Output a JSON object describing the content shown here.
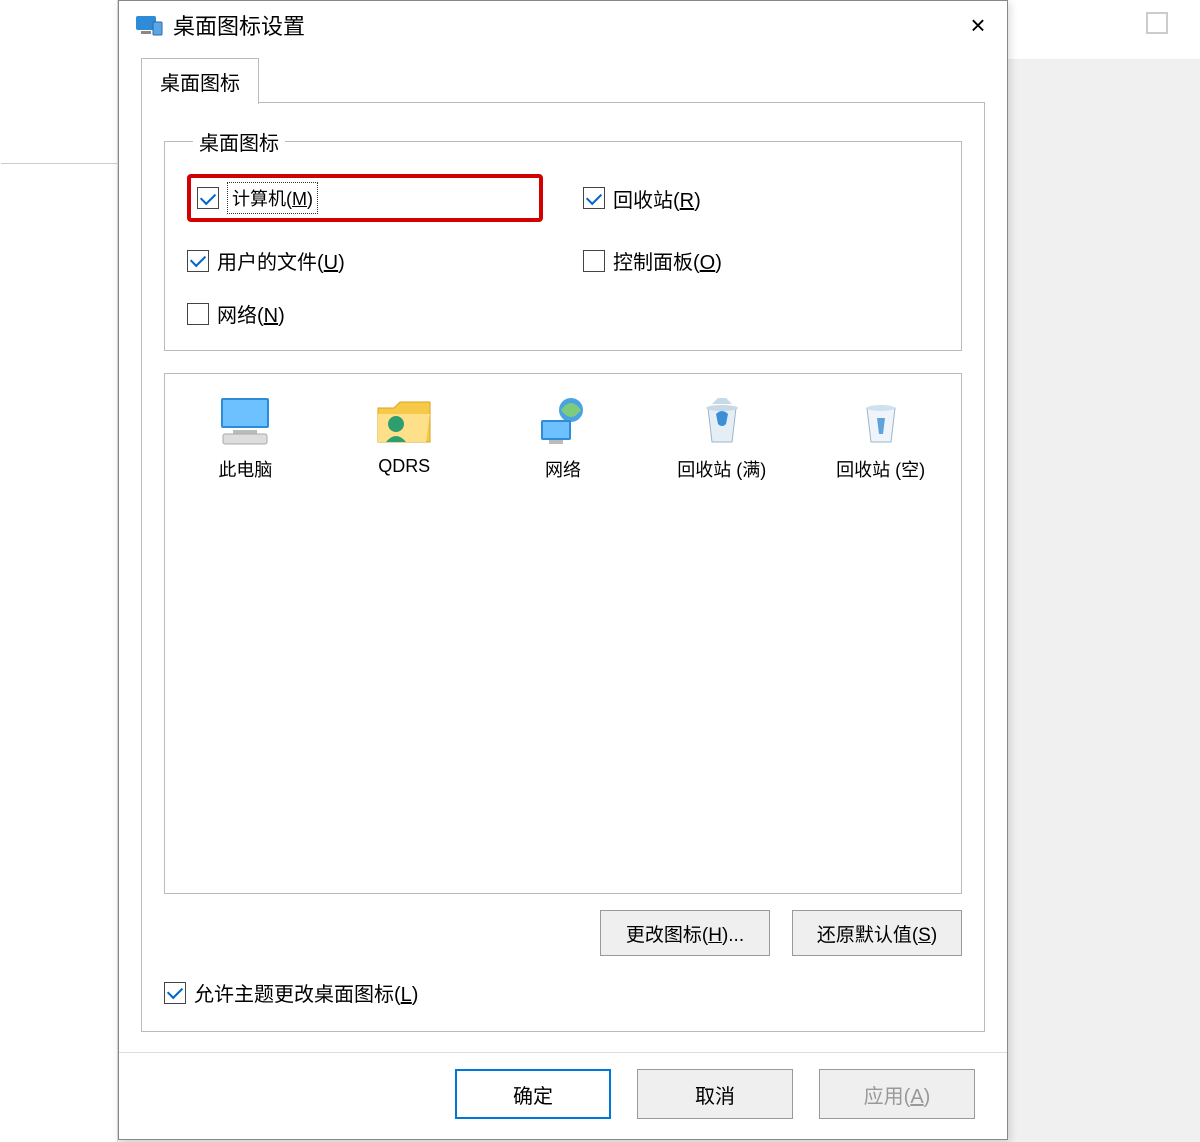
{
  "dialog": {
    "title": "桌面图标设置",
    "close": "×"
  },
  "tab": {
    "label": "桌面图标"
  },
  "group": {
    "legend": "桌面图标",
    "items": {
      "computer": {
        "checked": true,
        "label_pre": "计算机(",
        "akey": "M",
        "label_post": ")"
      },
      "recycle": {
        "checked": true,
        "label_pre": "回收站(",
        "akey": "R",
        "label_post": ")"
      },
      "userfiles": {
        "checked": true,
        "label_pre": "用户的文件(",
        "akey": "U",
        "label_post": ")"
      },
      "control": {
        "checked": false,
        "label_pre": "控制面板(",
        "akey": "O",
        "label_post": ")"
      },
      "network": {
        "checked": false,
        "label_pre": "网络(",
        "akey": "N",
        "label_post": ")"
      }
    }
  },
  "icons": {
    "list": [
      {
        "name": "thispc",
        "label": "此电脑"
      },
      {
        "name": "userfolder",
        "label": "QDRS"
      },
      {
        "name": "network",
        "label": "网络"
      },
      {
        "name": "recycle_full",
        "label": "回收站 (满)"
      },
      {
        "name": "recycle_empty",
        "label": "回收站 (空)"
      }
    ]
  },
  "buttons": {
    "change_icon": {
      "label_pre": "更改图标(",
      "akey": "H",
      "label_post": ")..."
    },
    "restore": {
      "label_pre": "还原默认值(",
      "akey": "S",
      "label_post": ")"
    }
  },
  "allow_theme": {
    "checked": true,
    "label_pre": "允许主题更改桌面图标(",
    "akey": "L",
    "label_post": ")"
  },
  "footer": {
    "ok": "确定",
    "cancel": "取消",
    "apply": {
      "label_pre": "应用(",
      "akey": "A",
      "label_post": ")"
    }
  }
}
